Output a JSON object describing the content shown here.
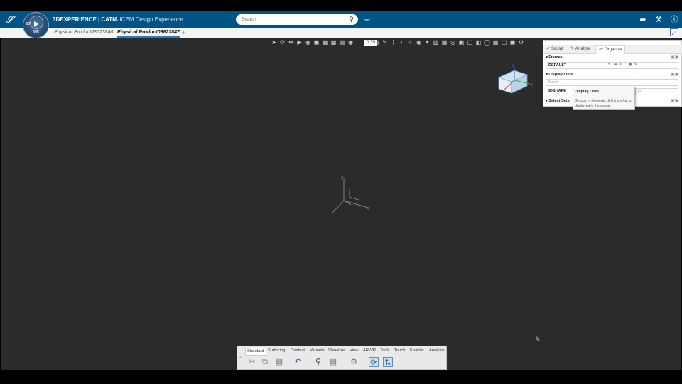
{
  "app": {
    "brand_icon": "3ds-logo",
    "title_brand": "3DEXPERIENCE",
    "title_sep": " | ",
    "title_product": "CATIA",
    "title_sub": " ICEM Design Experience",
    "compass_label": "3D",
    "compass_version": "V.R"
  },
  "search": {
    "placeholder": "Search"
  },
  "tabs": [
    {
      "label": "Physical Product03623846"
    },
    {
      "label": "Physical Product03623847"
    }
  ],
  "tab_add": "+",
  "viewport": {
    "zoom_value": "0.39"
  },
  "panel": {
    "tabs": [
      {
        "label": "Sculpt",
        "icon": "sculpt-icon"
      },
      {
        "label": "Analyze",
        "icon": "analyze-icon"
      },
      {
        "label": "Organize",
        "icon": "organize-icon"
      }
    ],
    "frames": {
      "title": "Frames",
      "value": "DEFAULT"
    },
    "display_lists": {
      "title": "Display Lists",
      "value": "None",
      "item": "3DSHAPE",
      "item_tag": "[1]"
    },
    "select_sets": {
      "title": "Select Sets"
    }
  },
  "tooltip": {
    "title": "Display Lists",
    "description": "Groups of elements defining what is displayed in the scene."
  },
  "bottom_toolbar": {
    "tabs": [
      "Standard",
      "Surfacing",
      "Context",
      "Variants",
      "Visualize",
      "View",
      "AR-VR",
      "Tools",
      "Touch",
      "Enabler",
      "Analysis"
    ]
  },
  "axis_labels": {
    "x": "X",
    "y": "Y",
    "z": "Z"
  },
  "colors": {
    "topbar": "#005386",
    "viewport": "#2b2b2b",
    "accent": "#2a7abf"
  }
}
